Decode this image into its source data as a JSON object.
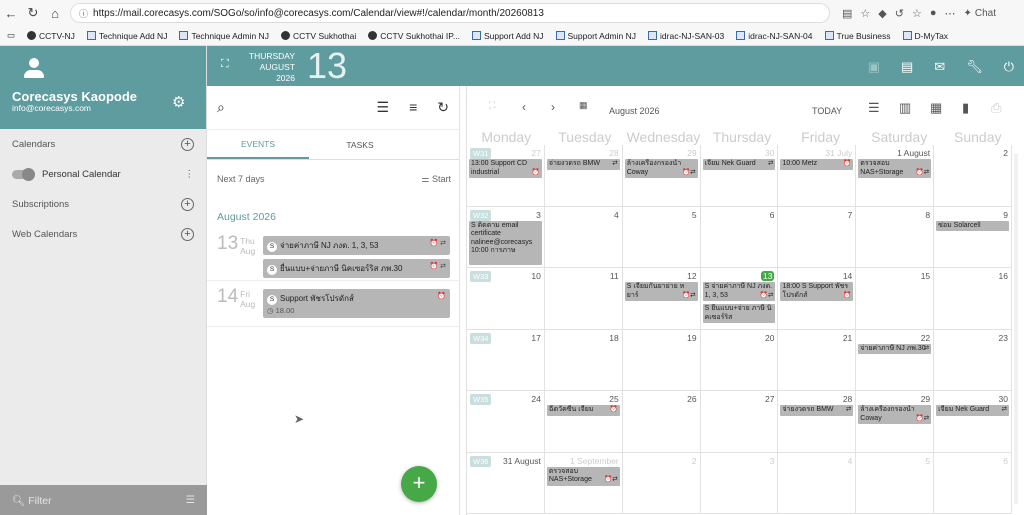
{
  "browser": {
    "url": "https://mail.corecasys.com/SOGo/so/info@corecasys.com/Calendar/view#!/calendar/month/20260813",
    "chat": "Chat"
  },
  "bookmarks": [
    "CCTV-NJ",
    "Technique Add NJ",
    "Technique Admin NJ",
    "CCTV Sukhothai",
    "CCTV Sukhothai IP...",
    "Support Add NJ",
    "Support Admin NJ",
    "idrac-NJ-SAN-03",
    "idrac-NJ-SAN-04",
    "True Business",
    "D-MyTax"
  ],
  "user": {
    "name": "Corecasys Kaopode",
    "email": "info@corecasys.com"
  },
  "sidebar": {
    "calendars": "Calendars",
    "personal": "Personal Calendar",
    "subscriptions": "Subscriptions",
    "web": "Web Calendars",
    "filter": "Filter"
  },
  "topbar": {
    "weekday": "THURSDAY",
    "month": "AUGUST",
    "year": "2026",
    "day": "13"
  },
  "events_pane": {
    "tab_events": "EVENTS",
    "tab_tasks": "TASKS",
    "range": "Next 7 days",
    "sort": "Start",
    "month": "August 2026",
    "days": [
      {
        "num": "13",
        "wd": "Thu",
        "mon": "Aug",
        "events": [
          {
            "badge": "S",
            "title": "จ่ายค่าภาษี NJ ภงด. 1, 3, 53",
            "time": "",
            "icons": "⏰ ⇄"
          },
          {
            "badge": "S",
            "title": "ยื่นแบบ+จ่ายภาษี นิคเซอร์ริส ภพ.30",
            "time": "",
            "icons": "⏰ ⇄"
          }
        ]
      },
      {
        "num": "14",
        "wd": "Fri",
        "mon": "Aug",
        "events": [
          {
            "badge": "S",
            "title": "Support พัชรโปรดักส์",
            "time": "18.00",
            "icons": "⏰"
          }
        ]
      }
    ]
  },
  "calendar": {
    "title": "August 2026",
    "today": "TODAY",
    "weekdays": [
      "Monday",
      "Tuesday",
      "Wednesday",
      "Thursday",
      "Friday",
      "Saturday",
      "Sunday"
    ],
    "weeks": [
      {
        "wk": "W31",
        "days": [
          {
            "n": "27",
            "out": true,
            "ev": [
              {
                "t": "13:00 Support CD industrial",
                "i": "⏰"
              }
            ]
          },
          {
            "n": "28",
            "out": true,
            "ev": [
              {
                "t": "จ่ายงวดรถ BMW",
                "i": "⇄"
              }
            ]
          },
          {
            "n": "29",
            "out": true,
            "ev": [
              {
                "t": "ล้างเครื่องกรองน้ำ Coway",
                "i": "⏰⇄"
              }
            ]
          },
          {
            "n": "30",
            "out": true,
            "ev": [
              {
                "t": "เจียม Nek Guard",
                "i": "⇄"
              }
            ]
          },
          {
            "n": "31 July",
            "out": true,
            "ev": [
              {
                "t": "10:00 Metz",
                "i": "⏰"
              }
            ]
          },
          {
            "n": "1 August",
            "out": false,
            "ev": [
              {
                "t": "ตรวจสอบ NAS+Storage",
                "i": "⏰⇄"
              }
            ]
          },
          {
            "n": "2",
            "out": false,
            "ev": []
          }
        ]
      },
      {
        "wk": "W32",
        "days": [
          {
            "n": "3",
            "out": false,
            "ev": [
              {
                "t": "S ติดตาม email certificate nalinee@corecasys 10:00 การภาษ",
                "i": ""
              }
            ]
          },
          {
            "n": "4",
            "out": false,
            "ev": []
          },
          {
            "n": "5",
            "out": false,
            "ev": []
          },
          {
            "n": "6",
            "out": false,
            "ev": []
          },
          {
            "n": "7",
            "out": false,
            "ev": []
          },
          {
            "n": "8",
            "out": false,
            "ev": []
          },
          {
            "n": "9",
            "out": false,
            "ev": [
              {
                "t": "ซ่อม Solarcell",
                "i": ""
              }
            ]
          }
        ]
      },
      {
        "wk": "W33",
        "days": [
          {
            "n": "10",
            "out": false,
            "ev": []
          },
          {
            "n": "11",
            "out": false,
            "ev": []
          },
          {
            "n": "12",
            "out": false,
            "ev": [
              {
                "t": "S เจียมกันยาย่าย หยาร์",
                "i": "⏰⇄"
              }
            ]
          },
          {
            "n": "13",
            "out": false,
            "today": true,
            "ev": [
              {
                "t": "S จ่ายค่าภาษี NJ ภงด. 1, 3, 53",
                "i": "⏰⇄"
              },
              {
                "t": "S ยื่นแบบ+จ่าย ภาษี นิคเซอร์ริส",
                "i": ""
              }
            ]
          },
          {
            "n": "14",
            "out": false,
            "ev": [
              {
                "t": "18:00 S Support พัชรโปรดักส์",
                "i": "⏰"
              }
            ]
          },
          {
            "n": "15",
            "out": false,
            "ev": []
          },
          {
            "n": "16",
            "out": false,
            "ev": []
          }
        ]
      },
      {
        "wk": "W34",
        "days": [
          {
            "n": "17",
            "out": false,
            "ev": []
          },
          {
            "n": "18",
            "out": false,
            "ev": []
          },
          {
            "n": "19",
            "out": false,
            "ev": []
          },
          {
            "n": "20",
            "out": false,
            "ev": []
          },
          {
            "n": "21",
            "out": false,
            "ev": []
          },
          {
            "n": "22",
            "out": false,
            "ev": [
              {
                "t": "จ่ายค่าภาษี NJ ภพ.30",
                "i": "⇄"
              }
            ]
          },
          {
            "n": "23",
            "out": false,
            "ev": []
          }
        ]
      },
      {
        "wk": "W35",
        "days": [
          {
            "n": "24",
            "out": false,
            "ev": []
          },
          {
            "n": "25",
            "out": false,
            "ev": [
              {
                "t": "ฉีดวัคซีน เจียม",
                "i": "⏰"
              }
            ]
          },
          {
            "n": "26",
            "out": false,
            "ev": []
          },
          {
            "n": "27",
            "out": false,
            "ev": []
          },
          {
            "n": "28",
            "out": false,
            "ev": [
              {
                "t": "จ่ายงวดรถ BMW",
                "i": "⇄"
              }
            ]
          },
          {
            "n": "29",
            "out": false,
            "ev": [
              {
                "t": "ล้างเครื่องกรองน้ำ Coway",
                "i": "⏰⇄"
              }
            ]
          },
          {
            "n": "30",
            "out": false,
            "ev": [
              {
                "t": "เจียม Nek Guard",
                "i": "⇄"
              }
            ]
          }
        ]
      },
      {
        "wk": "W36",
        "days": [
          {
            "n": "31 August",
            "out": false,
            "ev": []
          },
          {
            "n": "1 September",
            "out": true,
            "ev": [
              {
                "t": "ตรวจสอบ NAS+Storage",
                "i": "⏰⇄"
              }
            ]
          },
          {
            "n": "2",
            "out": true,
            "ev": []
          },
          {
            "n": "3",
            "out": true,
            "ev": []
          },
          {
            "n": "4",
            "out": true,
            "ev": []
          },
          {
            "n": "5",
            "out": true,
            "ev": []
          },
          {
            "n": "6",
            "out": true,
            "ev": []
          }
        ]
      }
    ]
  }
}
